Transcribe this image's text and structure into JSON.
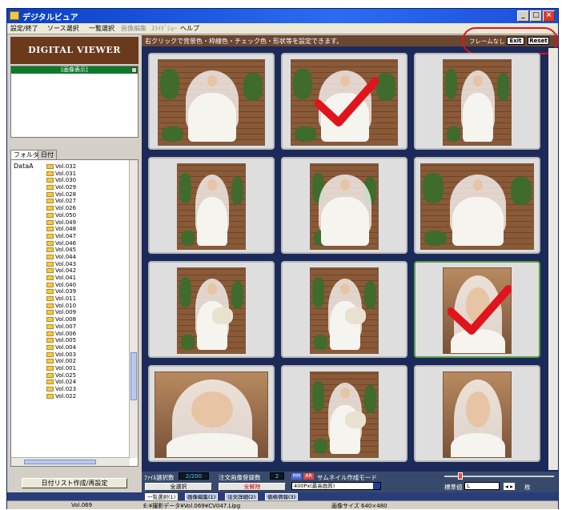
{
  "window": {
    "title": "デジタルビュア",
    "controls": [
      "_",
      "□",
      "×"
    ]
  },
  "menu": [
    "設定/終了",
    "ソース選択",
    "一覧選択",
    "画像編集",
    "ｽﾗｲﾄﾞｼｮｰ",
    "ヘルプ"
  ],
  "sidebar": {
    "brand": "DIGITAL VIEWER",
    "selection_header": "[画像表示]",
    "tabs": [
      "フォルダ",
      "日付"
    ],
    "tree_root": "DataA",
    "folders": [
      "Vol.032",
      "Vol.031",
      "Vol.030",
      "Vol.029",
      "Vol.028",
      "Vol.027",
      "Vol.026",
      "Vol.050",
      "Vol.049",
      "Vol.048",
      "Vol.047",
      "Vol.046",
      "Vol.045",
      "Vol.044",
      "Vol.043",
      "Vol.042",
      "Vol.041",
      "Vol.040",
      "Vol.039",
      "Vol.011",
      "Vol.010",
      "Vol.009",
      "Vol.008",
      "Vol.007",
      "Vol.006",
      "Vol.005",
      "Vol.004",
      "Vol.003",
      "Vol.002",
      "Vol.001",
      "Vol.025",
      "Vol.024",
      "Vol.023",
      "Vol.022"
    ],
    "date_list_button": "日付リスト作成/再設定"
  },
  "main": {
    "hint": "右クリックで背景色・枠線色・チェック色・形状等を設定できます。",
    "frame_label": "フレームなし",
    "exit_label": "Exit",
    "reset_label": "Reset"
  },
  "thumbnails": [
    {
      "checked": false,
      "selected": false
    },
    {
      "checked": true,
      "selected": false
    },
    {
      "checked": false,
      "selected": false
    },
    {
      "checked": false,
      "selected": false
    },
    {
      "checked": false,
      "selected": false
    },
    {
      "checked": false,
      "selected": false
    },
    {
      "checked": false,
      "selected": false
    },
    {
      "checked": false,
      "selected": false
    },
    {
      "checked": true,
      "selected": true
    },
    {
      "checked": false,
      "selected": false
    },
    {
      "checked": false,
      "selected": false
    },
    {
      "checked": false,
      "selected": false
    }
  ],
  "controls": {
    "file_count_label": "ﾌｧｲﾙ選択数",
    "file_count_value": "2/200",
    "registered_label": "注文画像登録数",
    "registered_value": "2",
    "select_all": "全選択",
    "deselect_all": "全解除",
    "mode_boxes": [
      "RM",
      "AR"
    ],
    "thumb_mode_label": "サムネイル作成モード",
    "mode_value": "400Px(最高画質)",
    "std_label": "標準値",
    "size_value": "L",
    "size_unit": "枚"
  },
  "bottom_tabs": [
    "一覧選択(1)",
    "画像編集(1)",
    "注文詳細(2)",
    "価格情報(3)"
  ],
  "status": {
    "volume": "Vol.069",
    "path": "E:¥撮影データ¥Vol.069¥CV047.Lipg",
    "size": "画像サイズ 640×480"
  },
  "colors": {
    "brand_brown": "#6b3a1d",
    "selection_green": "#0e7a2c",
    "check_red": "#e0141c",
    "main_bg": "#1c2a5a"
  }
}
